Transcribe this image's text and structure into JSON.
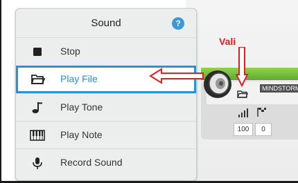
{
  "menu": {
    "title": "Sound",
    "help_glyph": "?",
    "items": [
      {
        "label": "Stop",
        "icon": "stop-icon"
      },
      {
        "label": "Play File",
        "icon": "folder-icon",
        "selected": true
      },
      {
        "label": "Play Tone",
        "icon": "music-note-icon"
      },
      {
        "label": "Play Note",
        "icon": "piano-keys-icon"
      },
      {
        "label": "Record Sound",
        "icon": "microphone-icon"
      }
    ]
  },
  "annotation": {
    "label": "Vali",
    "color": "#e02020"
  },
  "block": {
    "brand_text": "MINDSTORM",
    "volume_value": "100",
    "wait_value": "0",
    "accent_color": "#5faa2f"
  },
  "colors": {
    "selection": "#2f8fcf",
    "help": "#3a9ad9"
  }
}
